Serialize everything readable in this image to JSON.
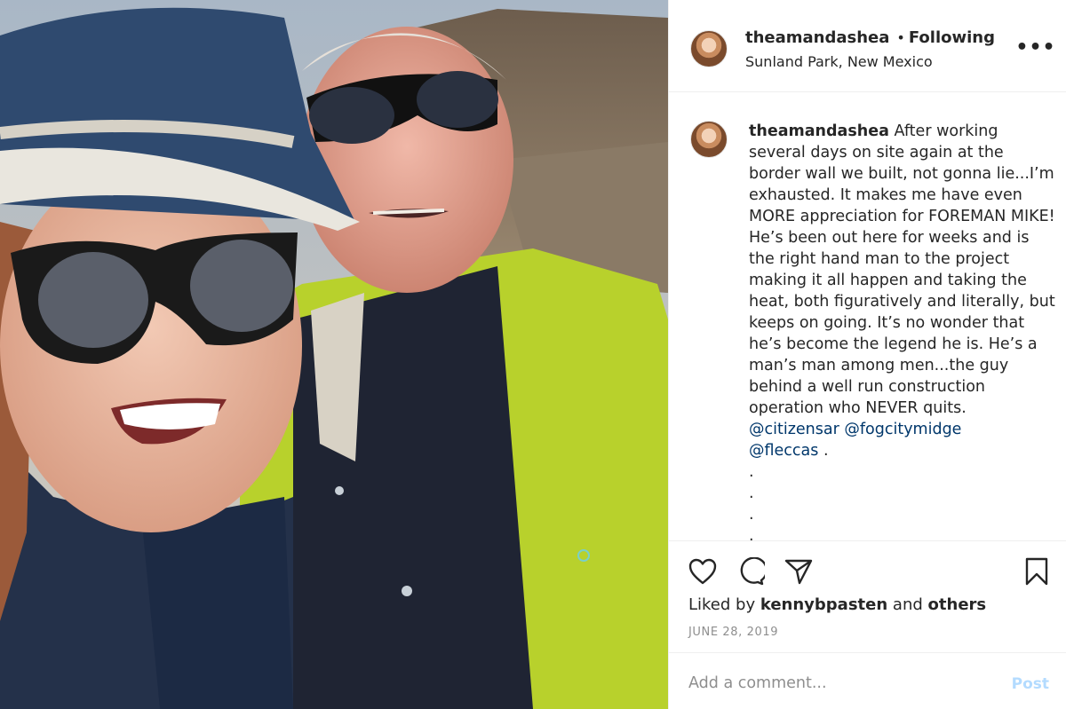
{
  "post": {
    "author": {
      "username": "theamandashea",
      "follow_status": "Following",
      "separator": "•",
      "location": "Sunland Park, New Mexico"
    },
    "more_options_label": "•••",
    "caption": {
      "username": "theamandashea",
      "text": "After working several days on site again at the border wall we built, not gonna lie...I’m exhausted. It makes me have even MORE appreciation for FOREMAN MIKE! He’s been out here for weeks and is the right hand man to the project making it all happen and taking the heat, both figuratively and literally, but keeps on going. It’s no wonder that he’s become the legend he is. He’s a man’s man among men...the guy behind a well run construction operation who NEVER quits.",
      "mentions": [
        "@citizensar",
        "@fogcitymidge",
        "@fleccas"
      ],
      "trailing": ".",
      "dots": [
        ".",
        ".",
        ".",
        "."
      ]
    },
    "actions": {
      "like_icon": "heart-icon",
      "comment_icon": "comment-bubble-icon",
      "share_icon": "paper-plane-icon",
      "save_icon": "bookmark-icon"
    },
    "likes": {
      "prefix": "Liked by",
      "user": "kennybpasten",
      "connector": "and",
      "others": "others"
    },
    "date": "JUNE 28, 2019",
    "comment_box": {
      "placeholder": "Add a comment...",
      "post_label": "Post"
    }
  },
  "colors": {
    "text": "#262626",
    "secondary_text": "#8e8e8e",
    "mention": "#00376b",
    "post_button_disabled": "#b3dbff",
    "divider": "#efefef"
  }
}
